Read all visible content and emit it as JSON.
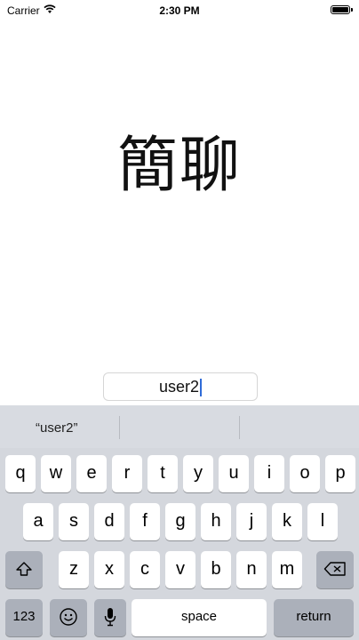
{
  "status_bar": {
    "carrier": "Carrier",
    "time": "2:30 PM",
    "icons": [
      "wifi-icon",
      "battery-icon"
    ]
  },
  "app": {
    "title": "簡聊"
  },
  "login": {
    "username_value": "user2"
  },
  "keyboard": {
    "suggestion": "“user2”",
    "rows": [
      [
        "q",
        "w",
        "e",
        "r",
        "t",
        "y",
        "u",
        "i",
        "o",
        "p"
      ],
      [
        "a",
        "s",
        "d",
        "f",
        "g",
        "h",
        "j",
        "k",
        "l"
      ],
      [
        "z",
        "x",
        "c",
        "v",
        "b",
        "n",
        "m"
      ]
    ],
    "numbers_key": "123",
    "space_key": "space",
    "return_key": "return",
    "icons": [
      "shift-icon",
      "backspace-icon",
      "emoji-icon",
      "microphone-icon"
    ]
  },
  "colors": {
    "keyboard_bg": "#d4d7dd",
    "function_key_bg": "#abb0ba",
    "caret": "#2f6bd8"
  }
}
